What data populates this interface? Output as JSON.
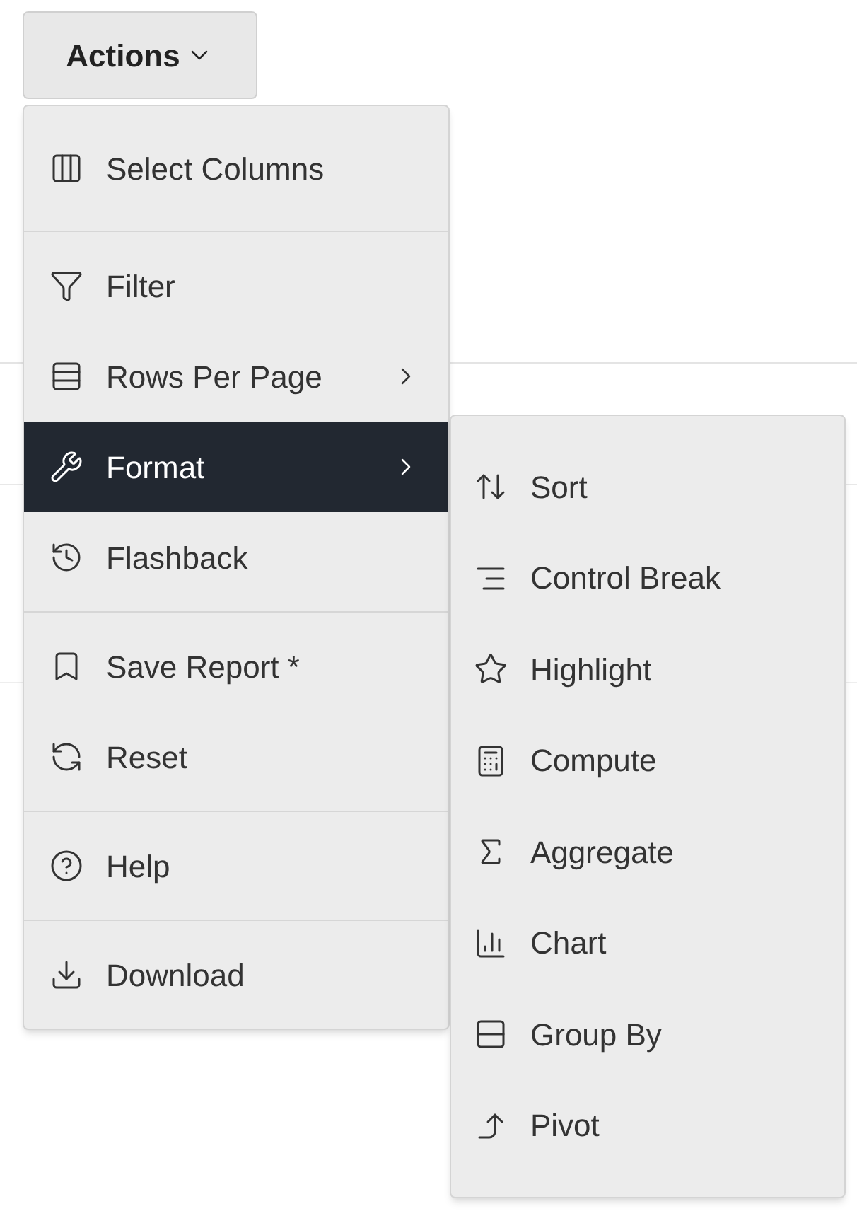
{
  "actions_button": {
    "label": "Actions"
  },
  "menu": {
    "groups": [
      [
        {
          "label": "Select Columns",
          "submenu": false,
          "selected": false
        }
      ],
      [
        {
          "label": "Filter",
          "submenu": false,
          "selected": false
        },
        {
          "label": "Rows Per Page",
          "submenu": true,
          "selected": false
        },
        {
          "label": "Format",
          "submenu": true,
          "selected": true
        },
        {
          "label": "Flashback",
          "submenu": false,
          "selected": false
        }
      ],
      [
        {
          "label": "Save Report *",
          "submenu": false,
          "selected": false
        },
        {
          "label": "Reset",
          "submenu": false,
          "selected": false
        }
      ],
      [
        {
          "label": "Help",
          "submenu": false,
          "selected": false
        }
      ],
      [
        {
          "label": "Download",
          "submenu": false,
          "selected": false
        }
      ]
    ]
  },
  "submenu": {
    "items": [
      {
        "label": "Sort"
      },
      {
        "label": "Control Break"
      },
      {
        "label": "Highlight"
      },
      {
        "label": "Compute"
      },
      {
        "label": "Aggregate"
      },
      {
        "label": "Chart"
      },
      {
        "label": "Group By"
      },
      {
        "label": "Pivot"
      }
    ]
  }
}
